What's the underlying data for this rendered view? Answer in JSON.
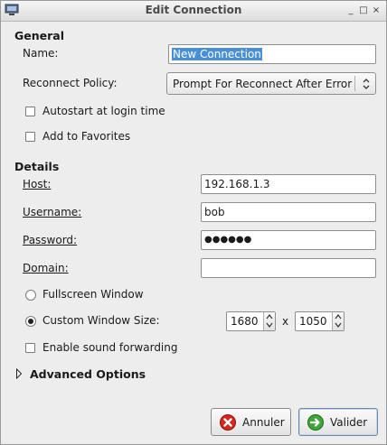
{
  "window": {
    "title": "Edit Connection",
    "controls": {
      "minimize": "_",
      "maximize": "□",
      "close": "×"
    }
  },
  "general": {
    "heading": "General",
    "name_label": "Name:",
    "name_value": "New Connection",
    "reconnect_label": "Reconnect Policy:",
    "reconnect_value": "Prompt For Reconnect After Error",
    "autostart_label": "Autostart at login time",
    "autostart_checked": false,
    "favorites_label": "Add to Favorites",
    "favorites_checked": false
  },
  "details": {
    "heading": "Details",
    "host_label": "Host:",
    "host_value": "192.168.1.3",
    "username_label": "Username:",
    "username_value": "bob",
    "password_label": "Password:",
    "password_value": "●●●●●●",
    "domain_label": "Domain:",
    "domain_value": "",
    "fullscreen_label": "Fullscreen Window",
    "custom_size_label": "Custom Window Size:",
    "selected_window_mode": "custom",
    "width_value": "1680",
    "times": "x",
    "height_value": "1050",
    "sound_label": "Enable sound forwarding",
    "sound_checked": false
  },
  "advanced": {
    "label": "Advanced Options",
    "expanded": false
  },
  "buttons": {
    "cancel_label": "Annuler",
    "ok_label": "Valider"
  },
  "colors": {
    "selection": "#4a90d9",
    "cancel_icon": "#d9251c",
    "ok_icon": "#3ea63a"
  },
  "icons": [
    "app-icon",
    "combo-arrow-icon",
    "spin-up-icon",
    "spin-down-icon",
    "expander-arrow-icon",
    "cancel-icon",
    "ok-icon"
  ]
}
